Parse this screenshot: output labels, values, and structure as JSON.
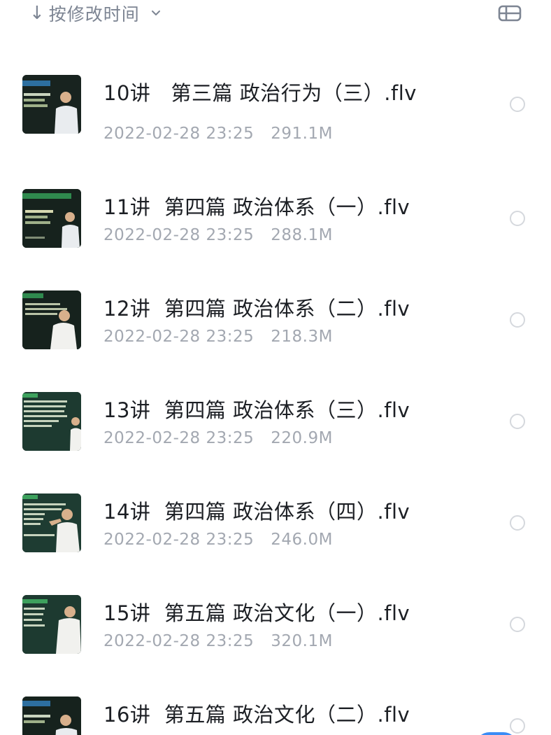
{
  "sort": {
    "arrow": "↓",
    "label": "按修改时间",
    "caret_icon": "chevron-down-icon",
    "view_icon": "list-view-icon"
  },
  "colors": {
    "title": "#1c1f24",
    "meta": "#a3a8b1",
    "sort": "#7d8593",
    "radio_border": "#d5d8dd",
    "accent": "#3b8cf5"
  },
  "files": [
    {
      "name": "10讲   第三篇 政治行为（三）.flv",
      "date": "2022-02-28 23:25",
      "size": "291.1M"
    },
    {
      "name": "11讲  第四篇 政治体系（一）.flv",
      "date": "2022-02-28 23:25",
      "size": "288.1M"
    },
    {
      "name": "12讲  第四篇 政治体系（二）.flv",
      "date": "2022-02-28 23:25",
      "size": "218.3M"
    },
    {
      "name": "13讲  第四篇 政治体系（三）.flv",
      "date": "2022-02-28 23:25",
      "size": "220.9M"
    },
    {
      "name": "14讲  第四篇 政治体系（四）.flv",
      "date": "2022-02-28 23:25",
      "size": "246.0M"
    },
    {
      "name": "15讲  第五篇 政治文化（一）.flv",
      "date": "2022-02-28 23:25",
      "size": "320.1M"
    },
    {
      "name": "16讲  第五篇 政治文化（二）.flv",
      "date": "",
      "size": ""
    }
  ]
}
